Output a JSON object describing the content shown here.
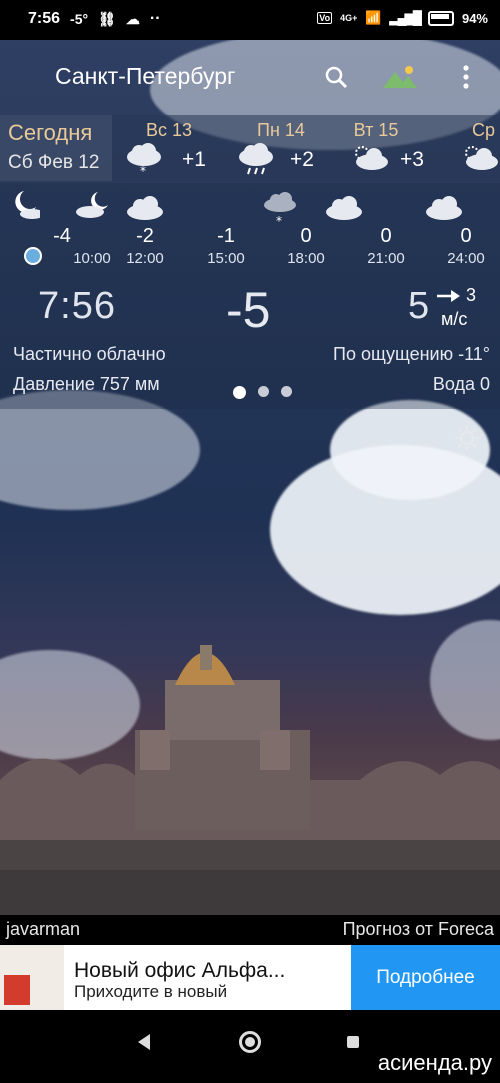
{
  "status": {
    "time": "7:56",
    "temp": "-5°",
    "battery": "94%",
    "network": "4G+"
  },
  "header": {
    "city": "Санкт-Петербург"
  },
  "daily": {
    "today_label": "Сегодня",
    "today_date": "Сб Фев 12",
    "days": [
      {
        "name": "Вс 13",
        "temp": "+1",
        "icon": "cloud-snow-icon"
      },
      {
        "name": "Пн 14",
        "temp": "+2",
        "icon": "cloud-rain-icon"
      },
      {
        "name": "Вт 15",
        "temp": "+3",
        "icon": "cloud-sun-icon"
      },
      {
        "name": "Ср",
        "temp": "",
        "icon": "cloud-sun-icon"
      }
    ]
  },
  "hourly": [
    {
      "time": "10:00",
      "temp": "-4",
      "icon": "moon-cloud-icon"
    },
    {
      "time": "12:00",
      "temp": "-2",
      "icon": "cloud-icon"
    },
    {
      "time": "15:00",
      "temp": "-1",
      "icon": "none"
    },
    {
      "time": "18:00",
      "temp": "0",
      "icon": "cloud-snow-icon"
    },
    {
      "time": "21:00",
      "temp": "0",
      "icon": "cloud-icon"
    },
    {
      "time": "24:00",
      "temp": "0",
      "icon": "cloud-icon"
    }
  ],
  "current": {
    "clock": "7:56",
    "temp": "-5",
    "wind_speed": "5",
    "wind_dir": "3",
    "wind_unit": "м/с",
    "condition": "Частично облачно",
    "feels_like": "По ощущению -11°",
    "pressure": "Давление 757 мм",
    "water": "Вода 0"
  },
  "footer": {
    "author": "javarman",
    "provider": "Прогноз от Foreca"
  },
  "ad": {
    "title": "Новый офис Альфа...",
    "subtitle": "Приходите в новый",
    "button": "Подробнее"
  },
  "watermark": "асиенда.ру",
  "colors": {
    "accent": "#e8c99a",
    "ad_button": "#2196f3",
    "now_dot": "#6aaee0"
  }
}
